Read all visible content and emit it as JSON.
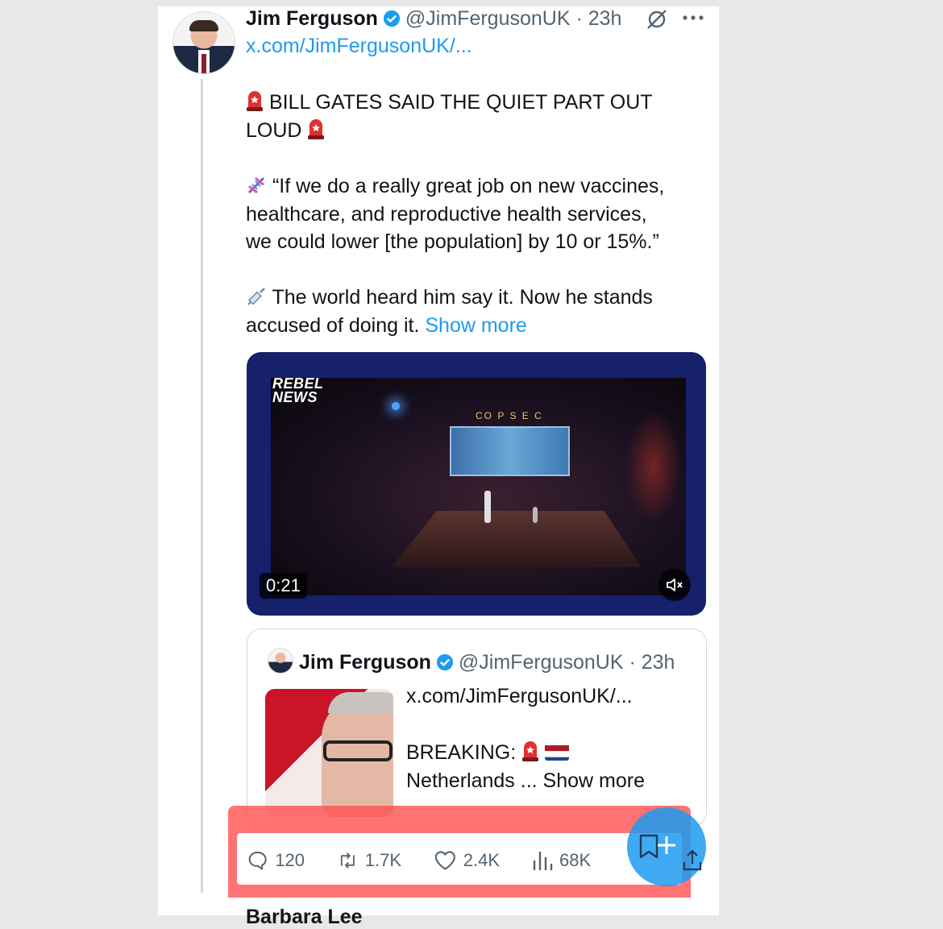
{
  "tweet": {
    "author_name": "Jim Ferguson",
    "handle_time": "@JimFergusonUK · 23h",
    "link": "x.com/JimFergusonUK/...",
    "line1": "BILL GATES SAID THE QUIET PART OUT",
    "line2": "LOUD",
    "quote_line1": "“If we do a really great job on new vaccines,",
    "quote_line2": "healthcare, and reproductive health services,",
    "quote_line3": "we could lower [the population] by 10 or 15%.”",
    "para3_line1": "The world heard him say it. Now he stands",
    "para3_line2": "accused of doing it.",
    "show_more": "Show more"
  },
  "video": {
    "logo_line1": "REBEL",
    "logo_line2": "NEWS",
    "screen_title": "CO P S E C",
    "duration": "0:21",
    "mute_icon": "volume-muted-icon"
  },
  "quoted_tweet": {
    "author_name": "Jim Ferguson",
    "handle_time": "@JimFergusonUK · 23h",
    "link": "x.com/JimFergusonUK/...",
    "breaking": "BREAKING:",
    "snippet": "Netherlands ... Show more"
  },
  "actions": {
    "replies": "120",
    "reposts": "1.7K",
    "likes": "2.4K",
    "views": "68K"
  },
  "next_tweet": {
    "author_partial": "Barbara Lee"
  },
  "colors": {
    "accent": "#1d9bf0",
    "text": "#0f1419",
    "muted": "#536471",
    "highlight": "#ff5050",
    "video_frame": "#16206b"
  }
}
